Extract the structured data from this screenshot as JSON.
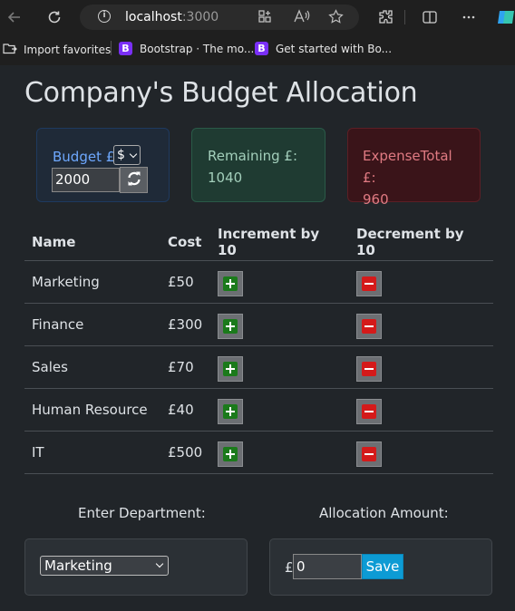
{
  "browser": {
    "url_host": "localhost",
    "url_port": ":3000",
    "favorites": [
      {
        "label": "Import favorites"
      },
      {
        "label": "Bootstrap · The mo...",
        "badge": "B"
      },
      {
        "label": "Get started with Bo...",
        "badge": "B"
      }
    ]
  },
  "page": {
    "title": "Company's Budget Allocation",
    "budget": {
      "label": "Budget £",
      "currency": "$",
      "value": "2000"
    },
    "remaining": {
      "label": "Remaining £:",
      "value": "1040"
    },
    "expense": {
      "label": "ExpenseTotal £:",
      "value": "960"
    },
    "table": {
      "headers": [
        "Name",
        "Cost",
        "Increment by 10",
        "Decrement by 10"
      ],
      "rows": [
        {
          "name": "Marketing",
          "cost": "£50"
        },
        {
          "name": "Finance",
          "cost": "£300"
        },
        {
          "name": "Sales",
          "cost": "£70"
        },
        {
          "name": "Human Resource",
          "cost": "£40"
        },
        {
          "name": "IT",
          "cost": "£500"
        }
      ]
    },
    "form": {
      "department_label": "Enter Department:",
      "department_value": "Marketing",
      "amount_label": "Allocation Amount:",
      "currency_symbol": "£",
      "amount_value": "0",
      "save_label": "Save"
    }
  },
  "colors": {
    "accent": "#0d9bd4",
    "increment": "#1b7a1b",
    "decrement": "#d41a1a"
  }
}
